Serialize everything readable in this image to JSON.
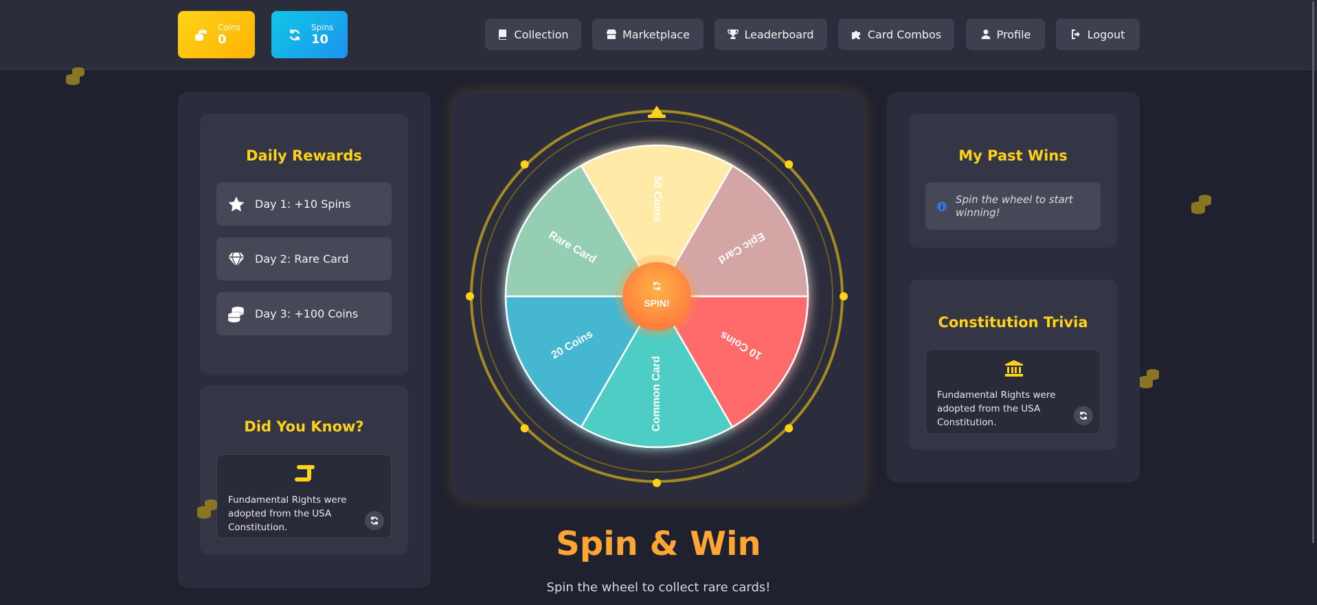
{
  "stats": {
    "coins": {
      "label": "Coins",
      "value": "0",
      "icon": "coins-icon"
    },
    "spins": {
      "label": "Spins",
      "value": "10",
      "icon": "sync-icon"
    }
  },
  "nav": {
    "collection": "Collection",
    "marketplace": "Marketplace",
    "leaderboard": "Leaderboard",
    "combos": "Card Combos",
    "profile": "Profile",
    "logout": "Logout"
  },
  "daily_rewards": {
    "title": "Daily Rewards",
    "items": [
      {
        "label": "Day 1: +10 Spins",
        "icon": "star-icon"
      },
      {
        "label": "Day 2: Rare Card",
        "icon": "gem-icon"
      },
      {
        "label": "Day 3: +100 Coins",
        "icon": "coins-icon"
      }
    ]
  },
  "did_you_know": {
    "title": "Did You Know?",
    "text": "Fundamental Rights were adopted from the USA Constitution.",
    "icon": "scroll-icon"
  },
  "wheel": {
    "spin_label": "SPIN!",
    "segments": [
      {
        "label": "50 Coins",
        "color": "#ffeaa7"
      },
      {
        "label": "Epic Card",
        "color": "#d4a5a5"
      },
      {
        "label": "10 Coins",
        "color": "#ff6b6b"
      },
      {
        "label": "Common Card",
        "color": "#4ecdc4"
      },
      {
        "label": "20 Coins",
        "color": "#45b7d1"
      },
      {
        "label": "Rare Card",
        "color": "#96ceb4"
      }
    ]
  },
  "main": {
    "title": "Spin & Win",
    "subtitle": "Spin the wheel to collect rare cards!"
  },
  "past_wins": {
    "title": "My Past Wins",
    "empty": "Spin the wheel to start winning!"
  },
  "trivia": {
    "title": "Constitution Trivia",
    "text": "Fundamental Rights were adopted from the USA Constitution.",
    "icon": "landmark-icon"
  },
  "colors": {
    "accent": "#ffd21a",
    "title": "#ffa533",
    "background": "#20212f"
  }
}
